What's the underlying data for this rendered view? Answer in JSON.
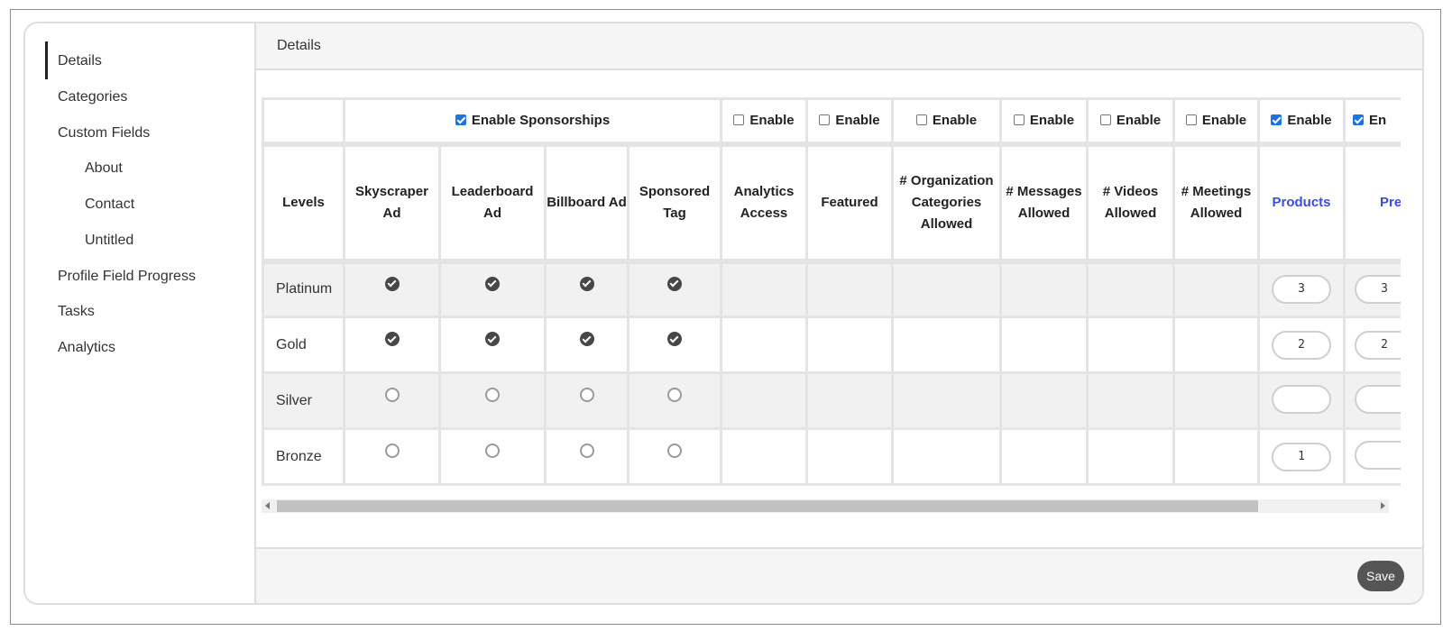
{
  "sidebar": {
    "items": [
      {
        "label": "Details"
      },
      {
        "label": "Categories"
      },
      {
        "label": "Custom Fields"
      },
      {
        "label": "About"
      },
      {
        "label": "Contact"
      },
      {
        "label": "Untitled"
      },
      {
        "label": "Profile Field Progress"
      },
      {
        "label": "Tasks"
      },
      {
        "label": "Analytics"
      }
    ]
  },
  "main": {
    "title": "Details",
    "save_label": "Save"
  },
  "table": {
    "enable_sponsorships": {
      "label": "Enable Sponsorships",
      "checked": true
    },
    "enable_label": "Enable",
    "enable_partial": "En",
    "enable_states": [
      false,
      false,
      false,
      false,
      false,
      false,
      true,
      true
    ],
    "headers": {
      "levels": "Levels",
      "skyscraper": "Skyscraper Ad",
      "leaderboard": "Leaderboard Ad",
      "billboard": "Billboard Ad",
      "sponsored": "Sponsored Tag",
      "analytics": "Analytics Access",
      "featured": "Featured",
      "org_categories": "# Organization Categories Allowed",
      "messages": "# Messages Allowed",
      "videos": "# Videos Allowed",
      "meetings": "# Meetings Allowed",
      "products": "Products",
      "press_partial": "Pre Rele"
    },
    "rows": [
      {
        "level": "Platinum",
        "sponsorships": [
          true,
          true,
          true,
          true
        ],
        "products": "3",
        "press": "3"
      },
      {
        "level": "Gold",
        "sponsorships": [
          true,
          true,
          true,
          true
        ],
        "products": "2",
        "press": "2"
      },
      {
        "level": "Silver",
        "sponsorships": [
          false,
          false,
          false,
          false
        ],
        "products": "",
        "press": ""
      },
      {
        "level": "Bronze",
        "sponsorships": [
          false,
          false,
          false,
          false
        ],
        "products": "1",
        "press": ""
      }
    ]
  }
}
